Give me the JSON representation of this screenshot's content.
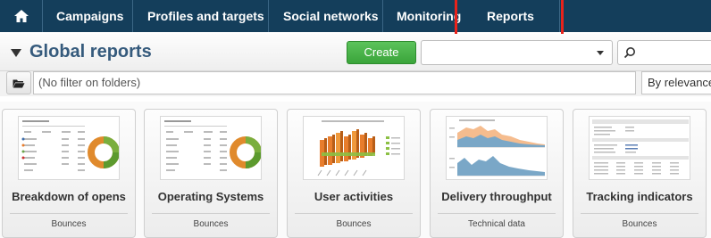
{
  "nav": {
    "home_icon": "home-icon",
    "items": [
      {
        "label": "Campaigns"
      },
      {
        "label": "Profiles and targets"
      },
      {
        "label": "Social networks"
      },
      {
        "label": "Monitoring"
      },
      {
        "label": "Reports"
      }
    ],
    "highlight_color": "#e8231c",
    "bar_color": "#143e5b"
  },
  "header": {
    "title": "Global reports",
    "create_label": "Create",
    "create_color": "#3aa43a",
    "select_value": "",
    "search_value": ""
  },
  "filter": {
    "folder_icon": "folder-icon",
    "placeholder": "(No filter on folders)",
    "sort_value": "By relevance"
  },
  "reports": [
    {
      "title": "Breakdown of opens",
      "category": "Bounces",
      "thumbnail": "donut-chart-thumbnail"
    },
    {
      "title": "Operating Systems",
      "category": "Bounces",
      "thumbnail": "donut-chart-thumbnail"
    },
    {
      "title": "User activities",
      "category": "Bounces",
      "thumbnail": "3d-bar-chart-thumbnail"
    },
    {
      "title": "Delivery throughput",
      "category": "Technical data",
      "thumbnail": "area-chart-thumbnail"
    },
    {
      "title": "Tracking indicators",
      "category": "Bounces",
      "thumbnail": "table-thumbnail"
    }
  ]
}
